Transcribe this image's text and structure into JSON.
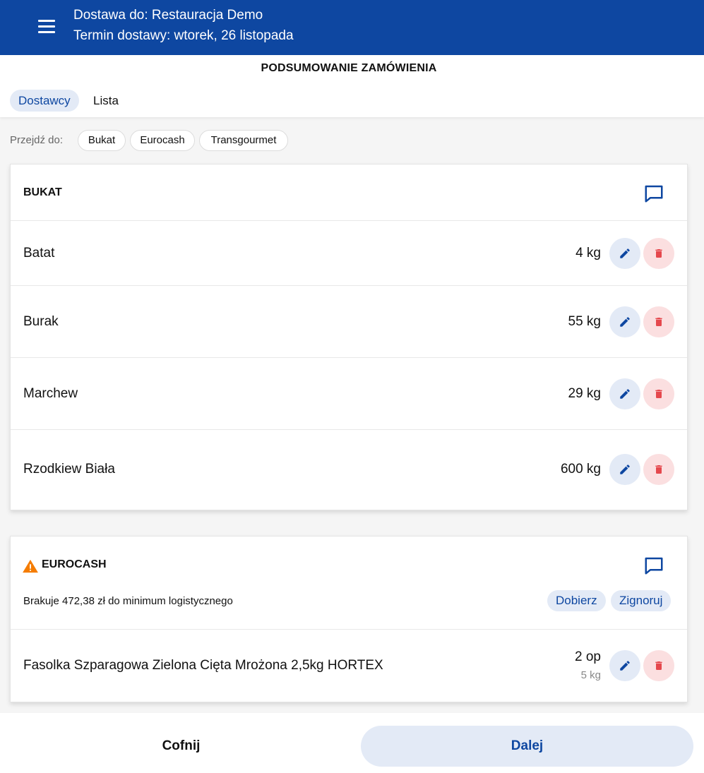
{
  "header": {
    "delivery_to": "Dostawa do: Restauracja Demo",
    "delivery_date": "Termin dostawy: wtorek, 26 listopada"
  },
  "title": "PODSUMOWANIE ZAMÓWIENIA",
  "tabs": [
    {
      "label": "Dostawcy",
      "active": true
    },
    {
      "label": "Lista",
      "active": false
    }
  ],
  "jump_to": {
    "label": "Przejdź do:",
    "chips": [
      "Bukat",
      "Eurocash",
      "Transgourmet"
    ]
  },
  "suppliers": [
    {
      "name": "BUKAT",
      "items": [
        {
          "name": "Batat",
          "quantity": "4 kg"
        },
        {
          "name": "Burak",
          "quantity": "55 kg"
        },
        {
          "name": "Marchew",
          "quantity": "29 kg"
        },
        {
          "name": "Rzodkiew Biała",
          "quantity": "600 kg"
        }
      ]
    },
    {
      "name": "EUROCASH",
      "warning": "Brakuje 472,38 zł do minimum logistycznego",
      "actions": [
        "Dobierz",
        "Zignoruj"
      ],
      "items": [
        {
          "name": "Fasolka Szparagowa Zielona Cięta Mrożona 2,5kg HORTEX",
          "quantity": "2 op",
          "sub_quantity": "5 kg"
        }
      ]
    }
  ],
  "footer": {
    "back_label": "Cofnij",
    "next_label": "Dalej"
  },
  "colors": {
    "primary": "#0e47a1",
    "primary_light": "#e3eaf6",
    "danger": "#e5484d",
    "danger_light": "#fbdfe0",
    "warning": "#f57c00"
  },
  "icons": {
    "menu": "menu-icon",
    "comment": "comment-icon",
    "edit": "pencil-icon",
    "delete": "trash-icon",
    "warning": "warning-icon"
  }
}
